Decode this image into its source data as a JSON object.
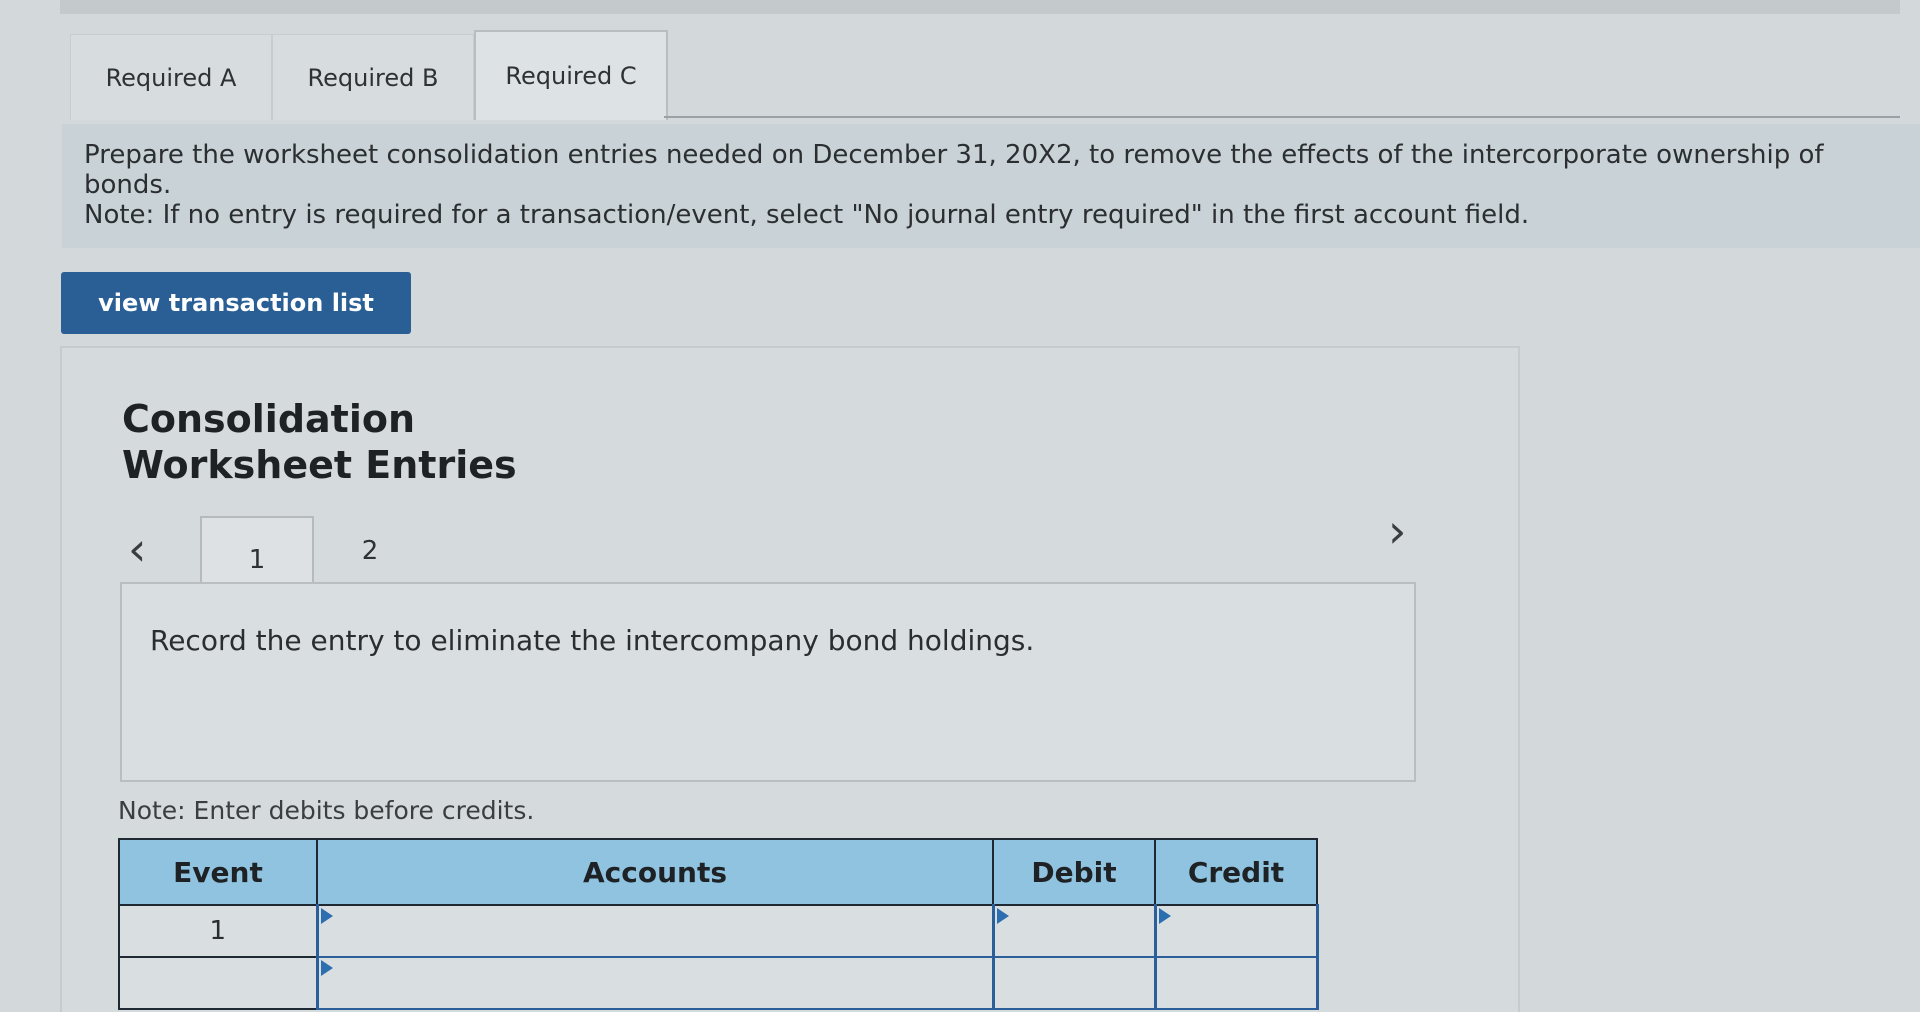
{
  "tabs": {
    "required_a": "Required A",
    "required_b": "Required B",
    "required_c": "Required C"
  },
  "instructions": {
    "main": "Prepare the worksheet consolidation entries needed on December 31, 20X2, to remove the effects of the intercorporate ownership of bonds.",
    "note": "Note: If no entry is required for a transaction/event, select \"No journal entry required\" in the first account field."
  },
  "buttons": {
    "view_transaction_list": "view transaction list"
  },
  "panel": {
    "title_line1": "Consolidation",
    "title_line2": "Worksheet Entries",
    "prev_icon": "‹",
    "next_icon": "›",
    "pages": [
      "1",
      "2"
    ],
    "entry_instruction": "Record the entry to eliminate the intercompany bond holdings.",
    "debit_note": "Note: Enter debits before credits."
  },
  "journal": {
    "headers": {
      "event": "Event",
      "accounts": "Accounts",
      "debit": "Debit",
      "credit": "Credit"
    },
    "rows": [
      {
        "event": "1"
      },
      {
        "event": ""
      }
    ]
  },
  "colors": {
    "header_bg": "#8fc3e0",
    "button_bg": "#2a5f96",
    "input_marker": "#2b6fb0"
  }
}
